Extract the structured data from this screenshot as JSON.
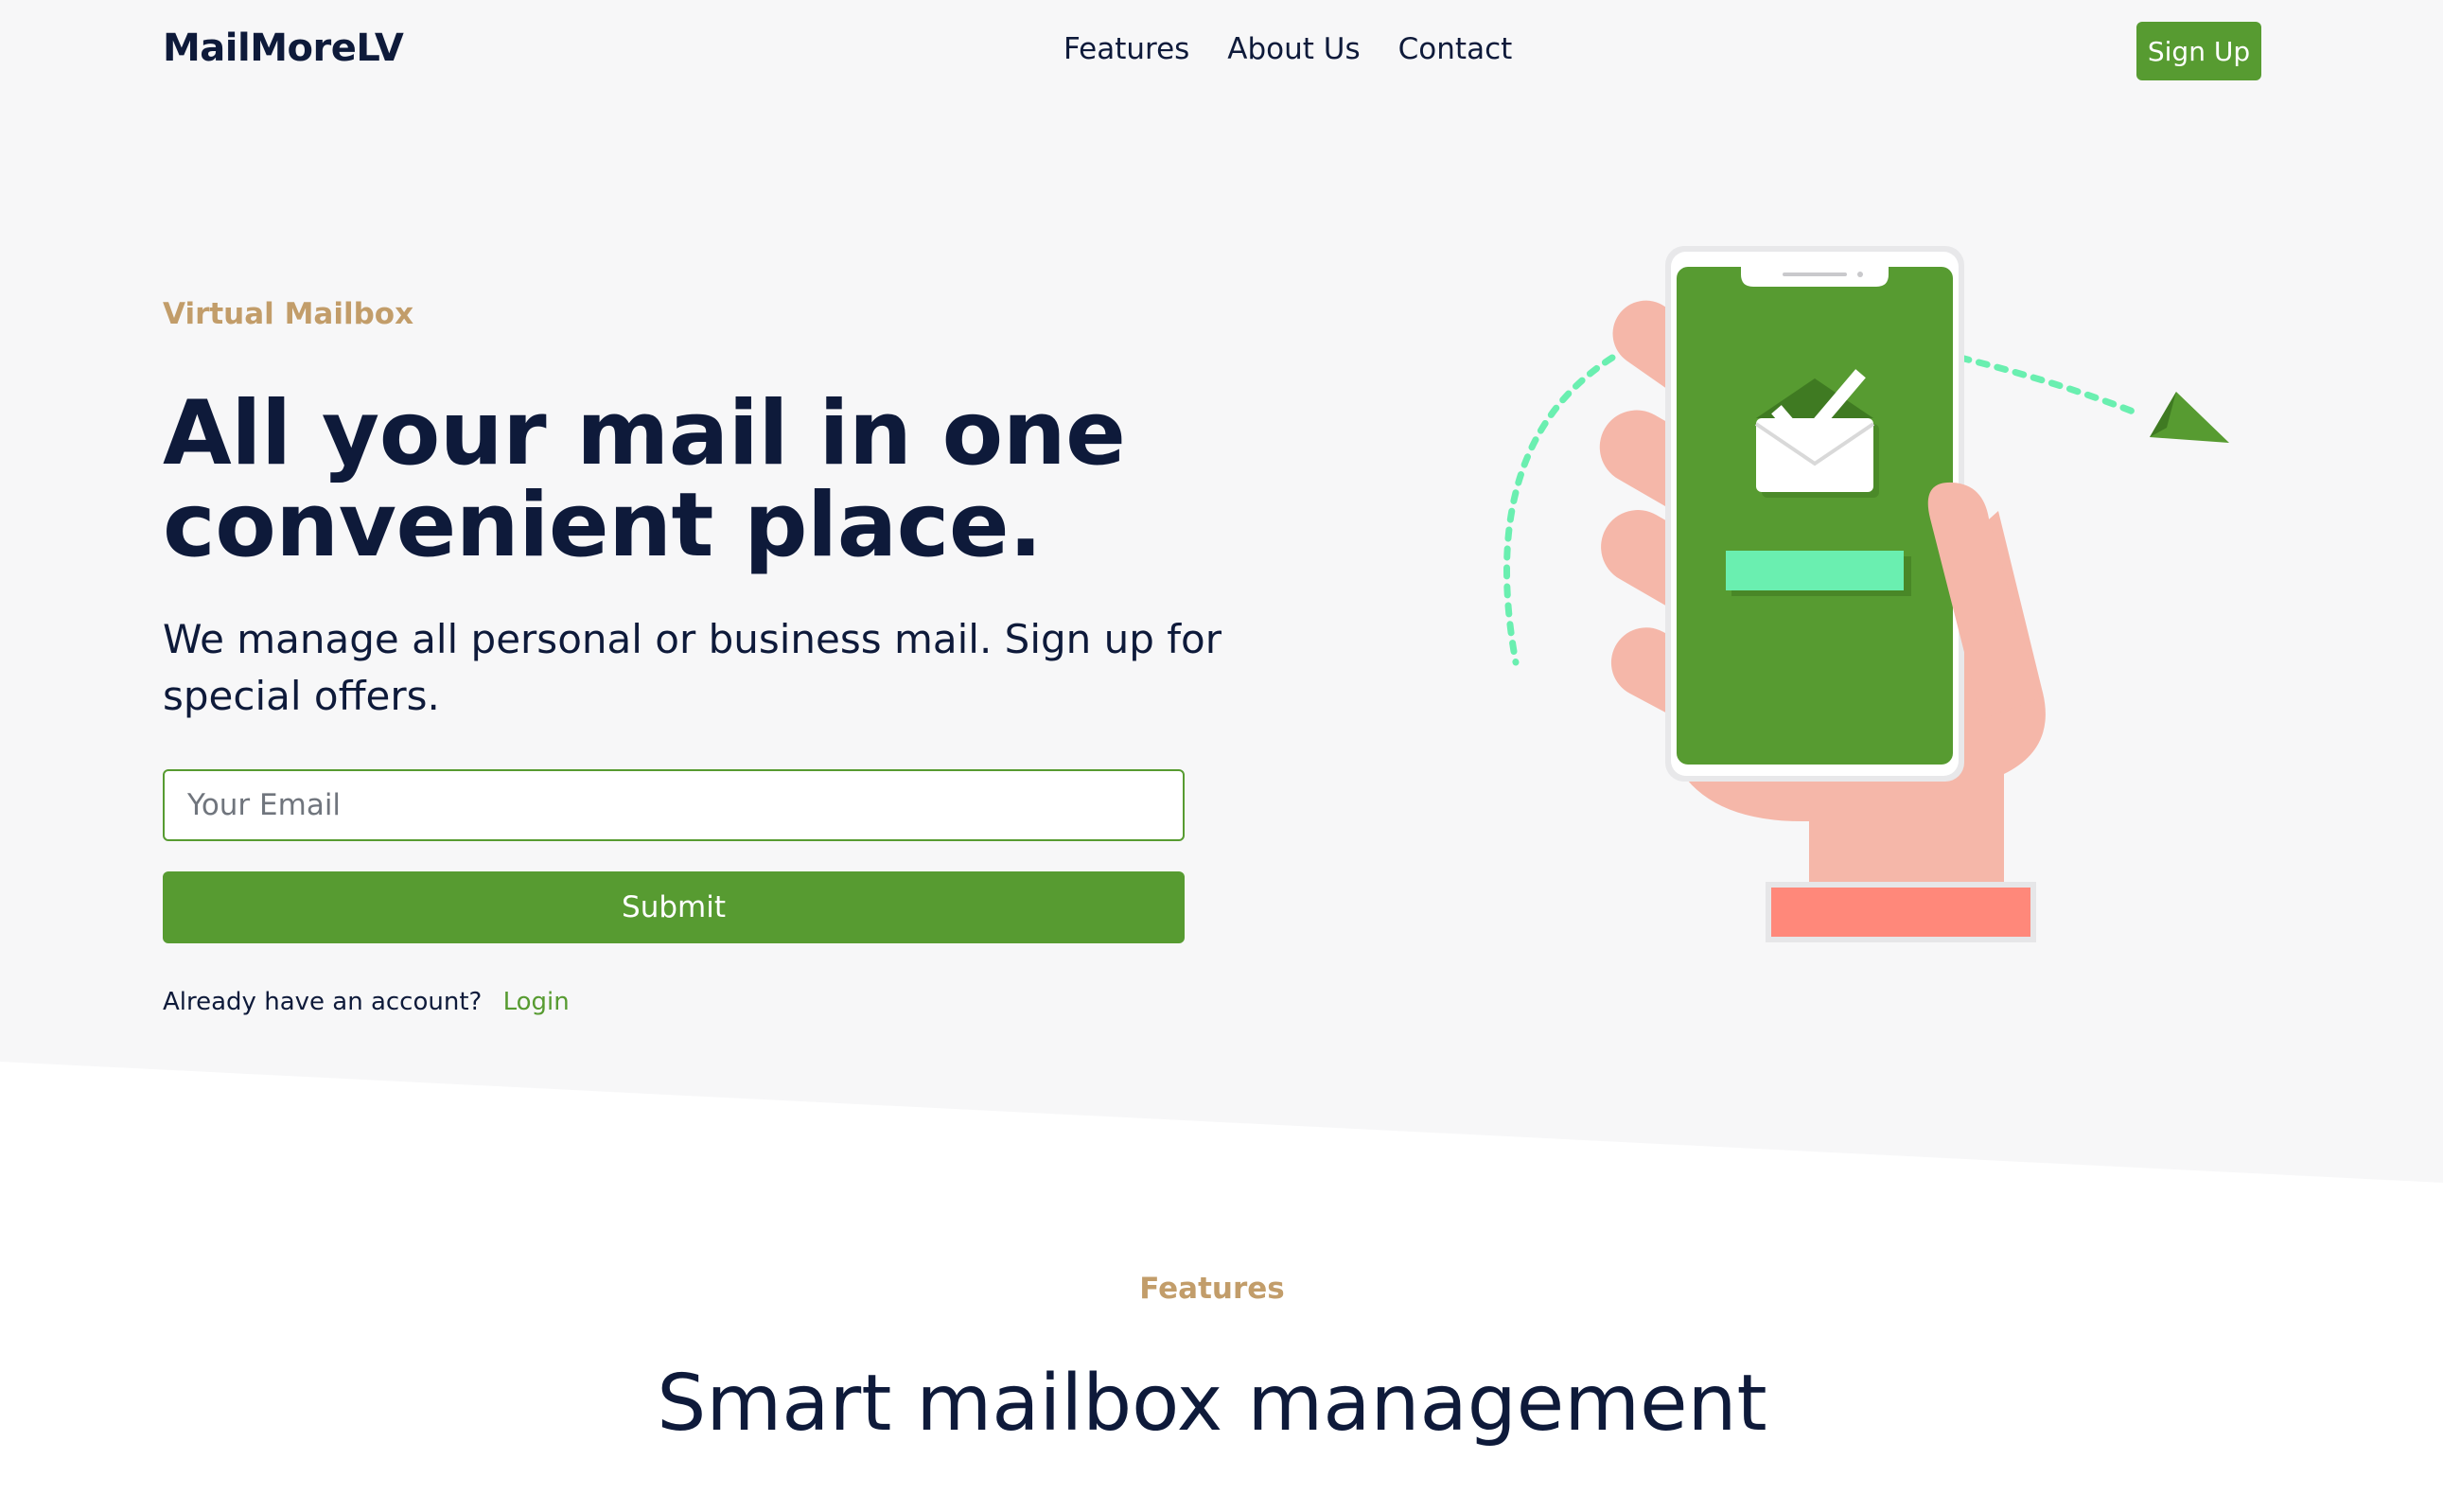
{
  "nav": {
    "brand": "MailMoreLV",
    "links": [
      "Features",
      "About Us",
      "Contact"
    ],
    "signup_label": "Sign Up"
  },
  "hero": {
    "eyebrow": "Virtual Mailbox",
    "headline_line1": "All your mail in one",
    "headline_line2": "convenient place.",
    "subtext": "We manage all personal or business mail. Sign up for special offers.",
    "email_placeholder": "Your Email",
    "email_value": "",
    "submit_label": "Submit",
    "account_prompt": "Already have an account?",
    "login_label": "Login"
  },
  "features": {
    "eyebrow": "Features",
    "title": "Smart mailbox management"
  },
  "colors": {
    "accent_green": "#579b31",
    "eyebrow_tan": "#c29d6a",
    "text_navy": "#0e1a3a",
    "hero_bg": "#f7f7f8",
    "mint": "#6aefb0",
    "skin": "#f5b7a9",
    "sleeve": "#ff887a"
  },
  "illustration": {
    "description_icon": "hand-holding-phone-with-mail-checkmark-icon"
  }
}
